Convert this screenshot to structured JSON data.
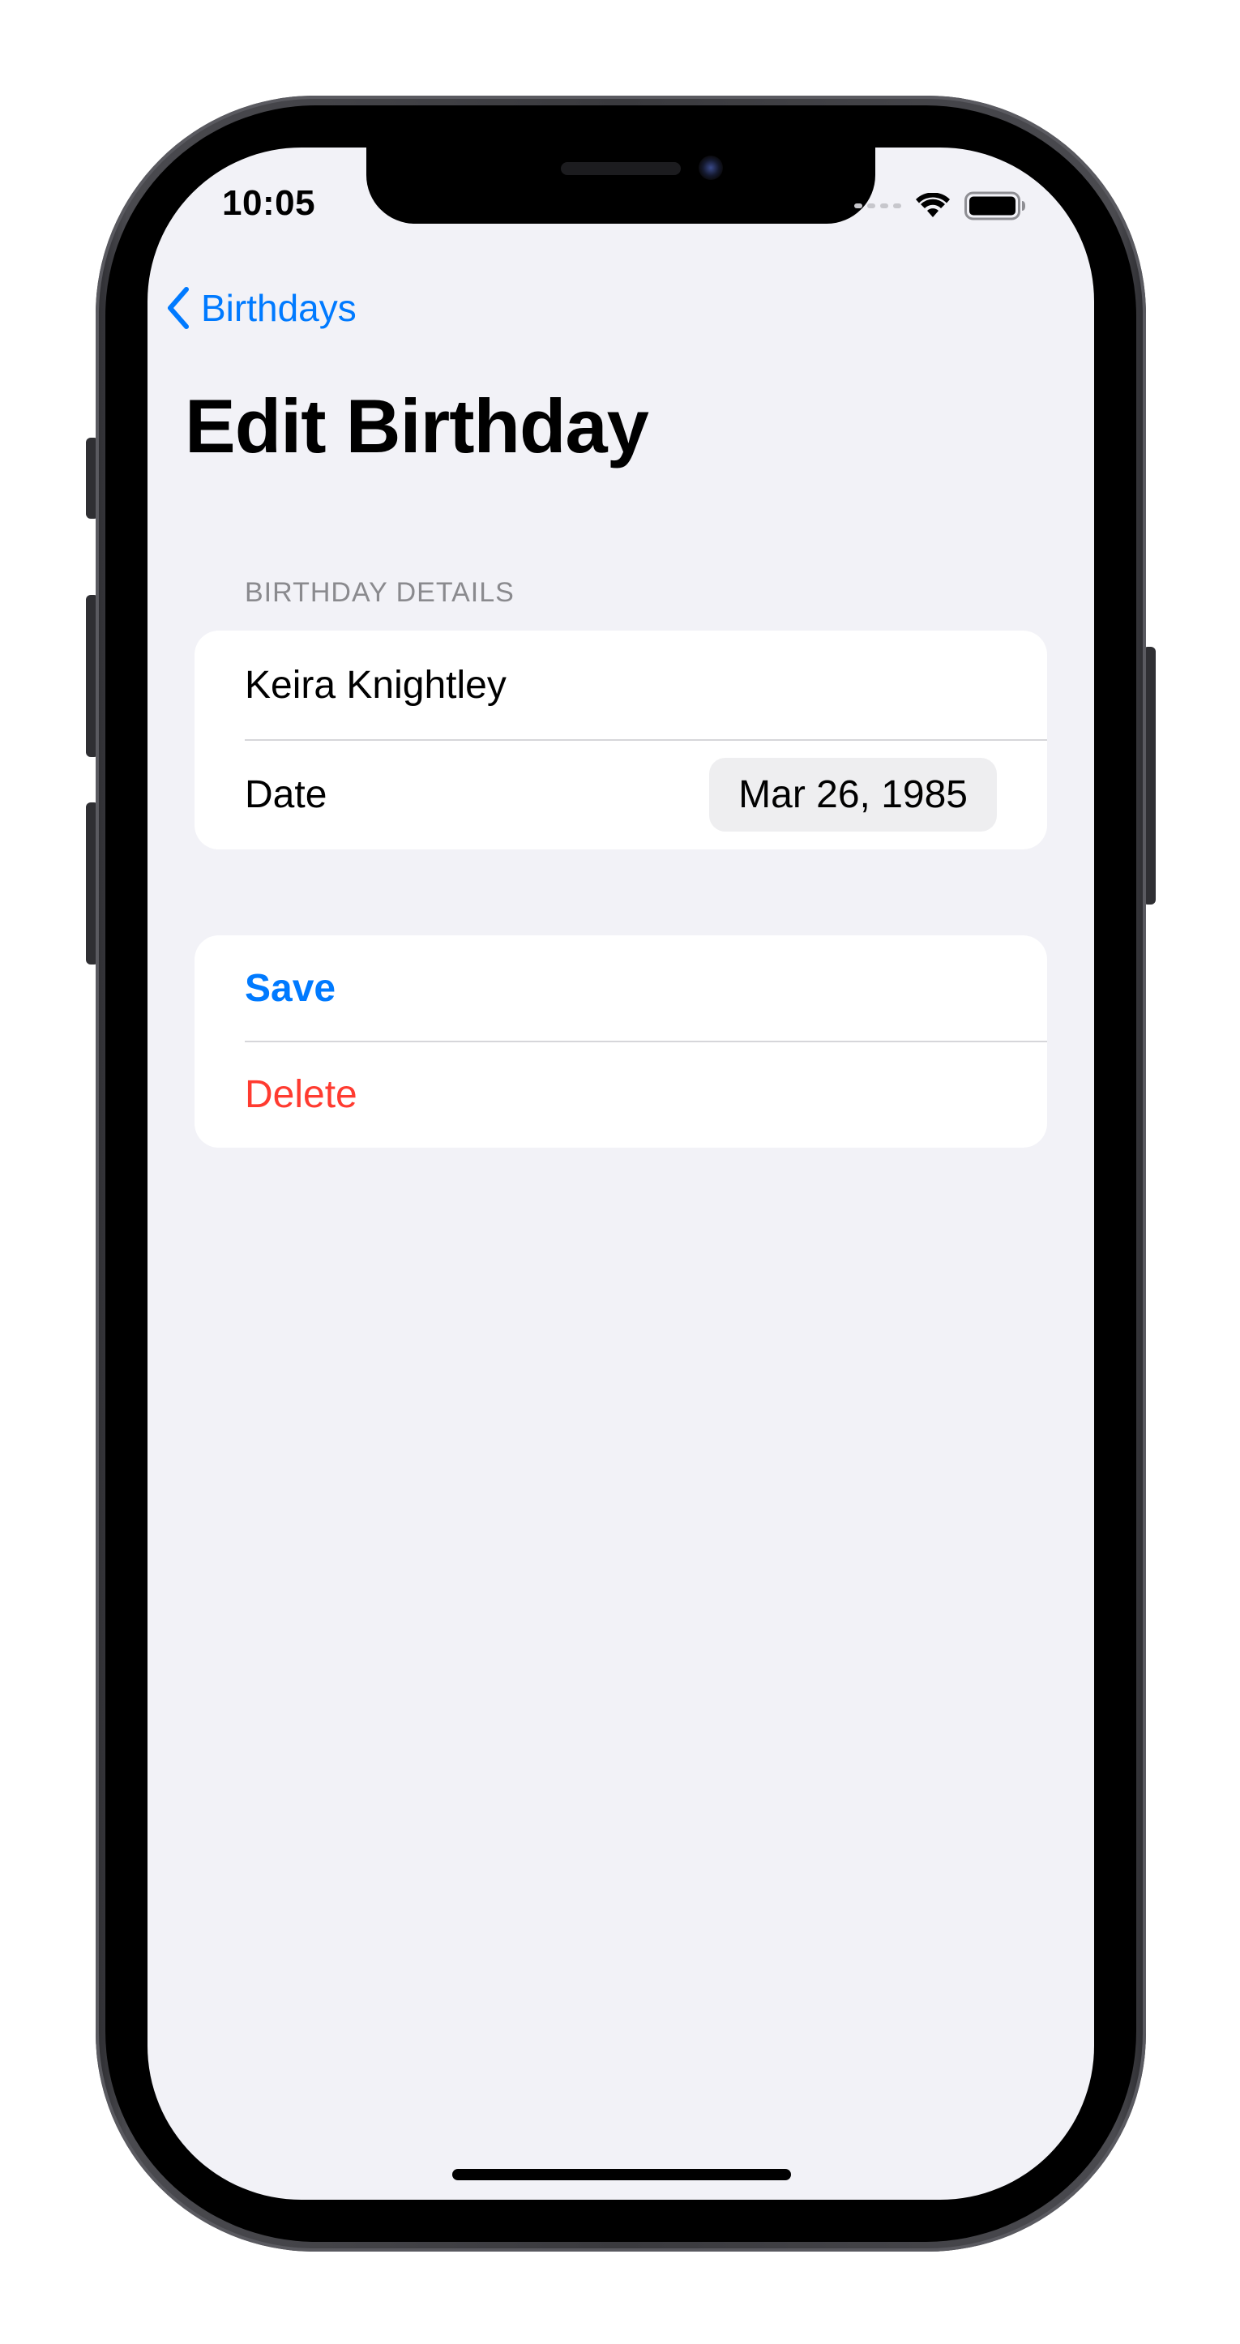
{
  "status_bar": {
    "time": "10:05",
    "icons": [
      "cellular-signal-icon",
      "wifi-icon",
      "battery-icon"
    ]
  },
  "nav": {
    "back_label": "Birthdays",
    "back_icon": "chevron-left-icon",
    "title": "Edit Birthday"
  },
  "birthday_details": {
    "header": "BIRTHDAY DETAILS",
    "name_value": "Keira Knightley",
    "date_label": "Date",
    "date_value": "Mar 26, 1985"
  },
  "actions": {
    "save_label": "Save",
    "delete_label": "Delete"
  },
  "colors": {
    "accent": "#007aff",
    "destructive": "#ff3b30",
    "background": "#f2f2f7",
    "secondary_text": "#8a8a8e"
  }
}
